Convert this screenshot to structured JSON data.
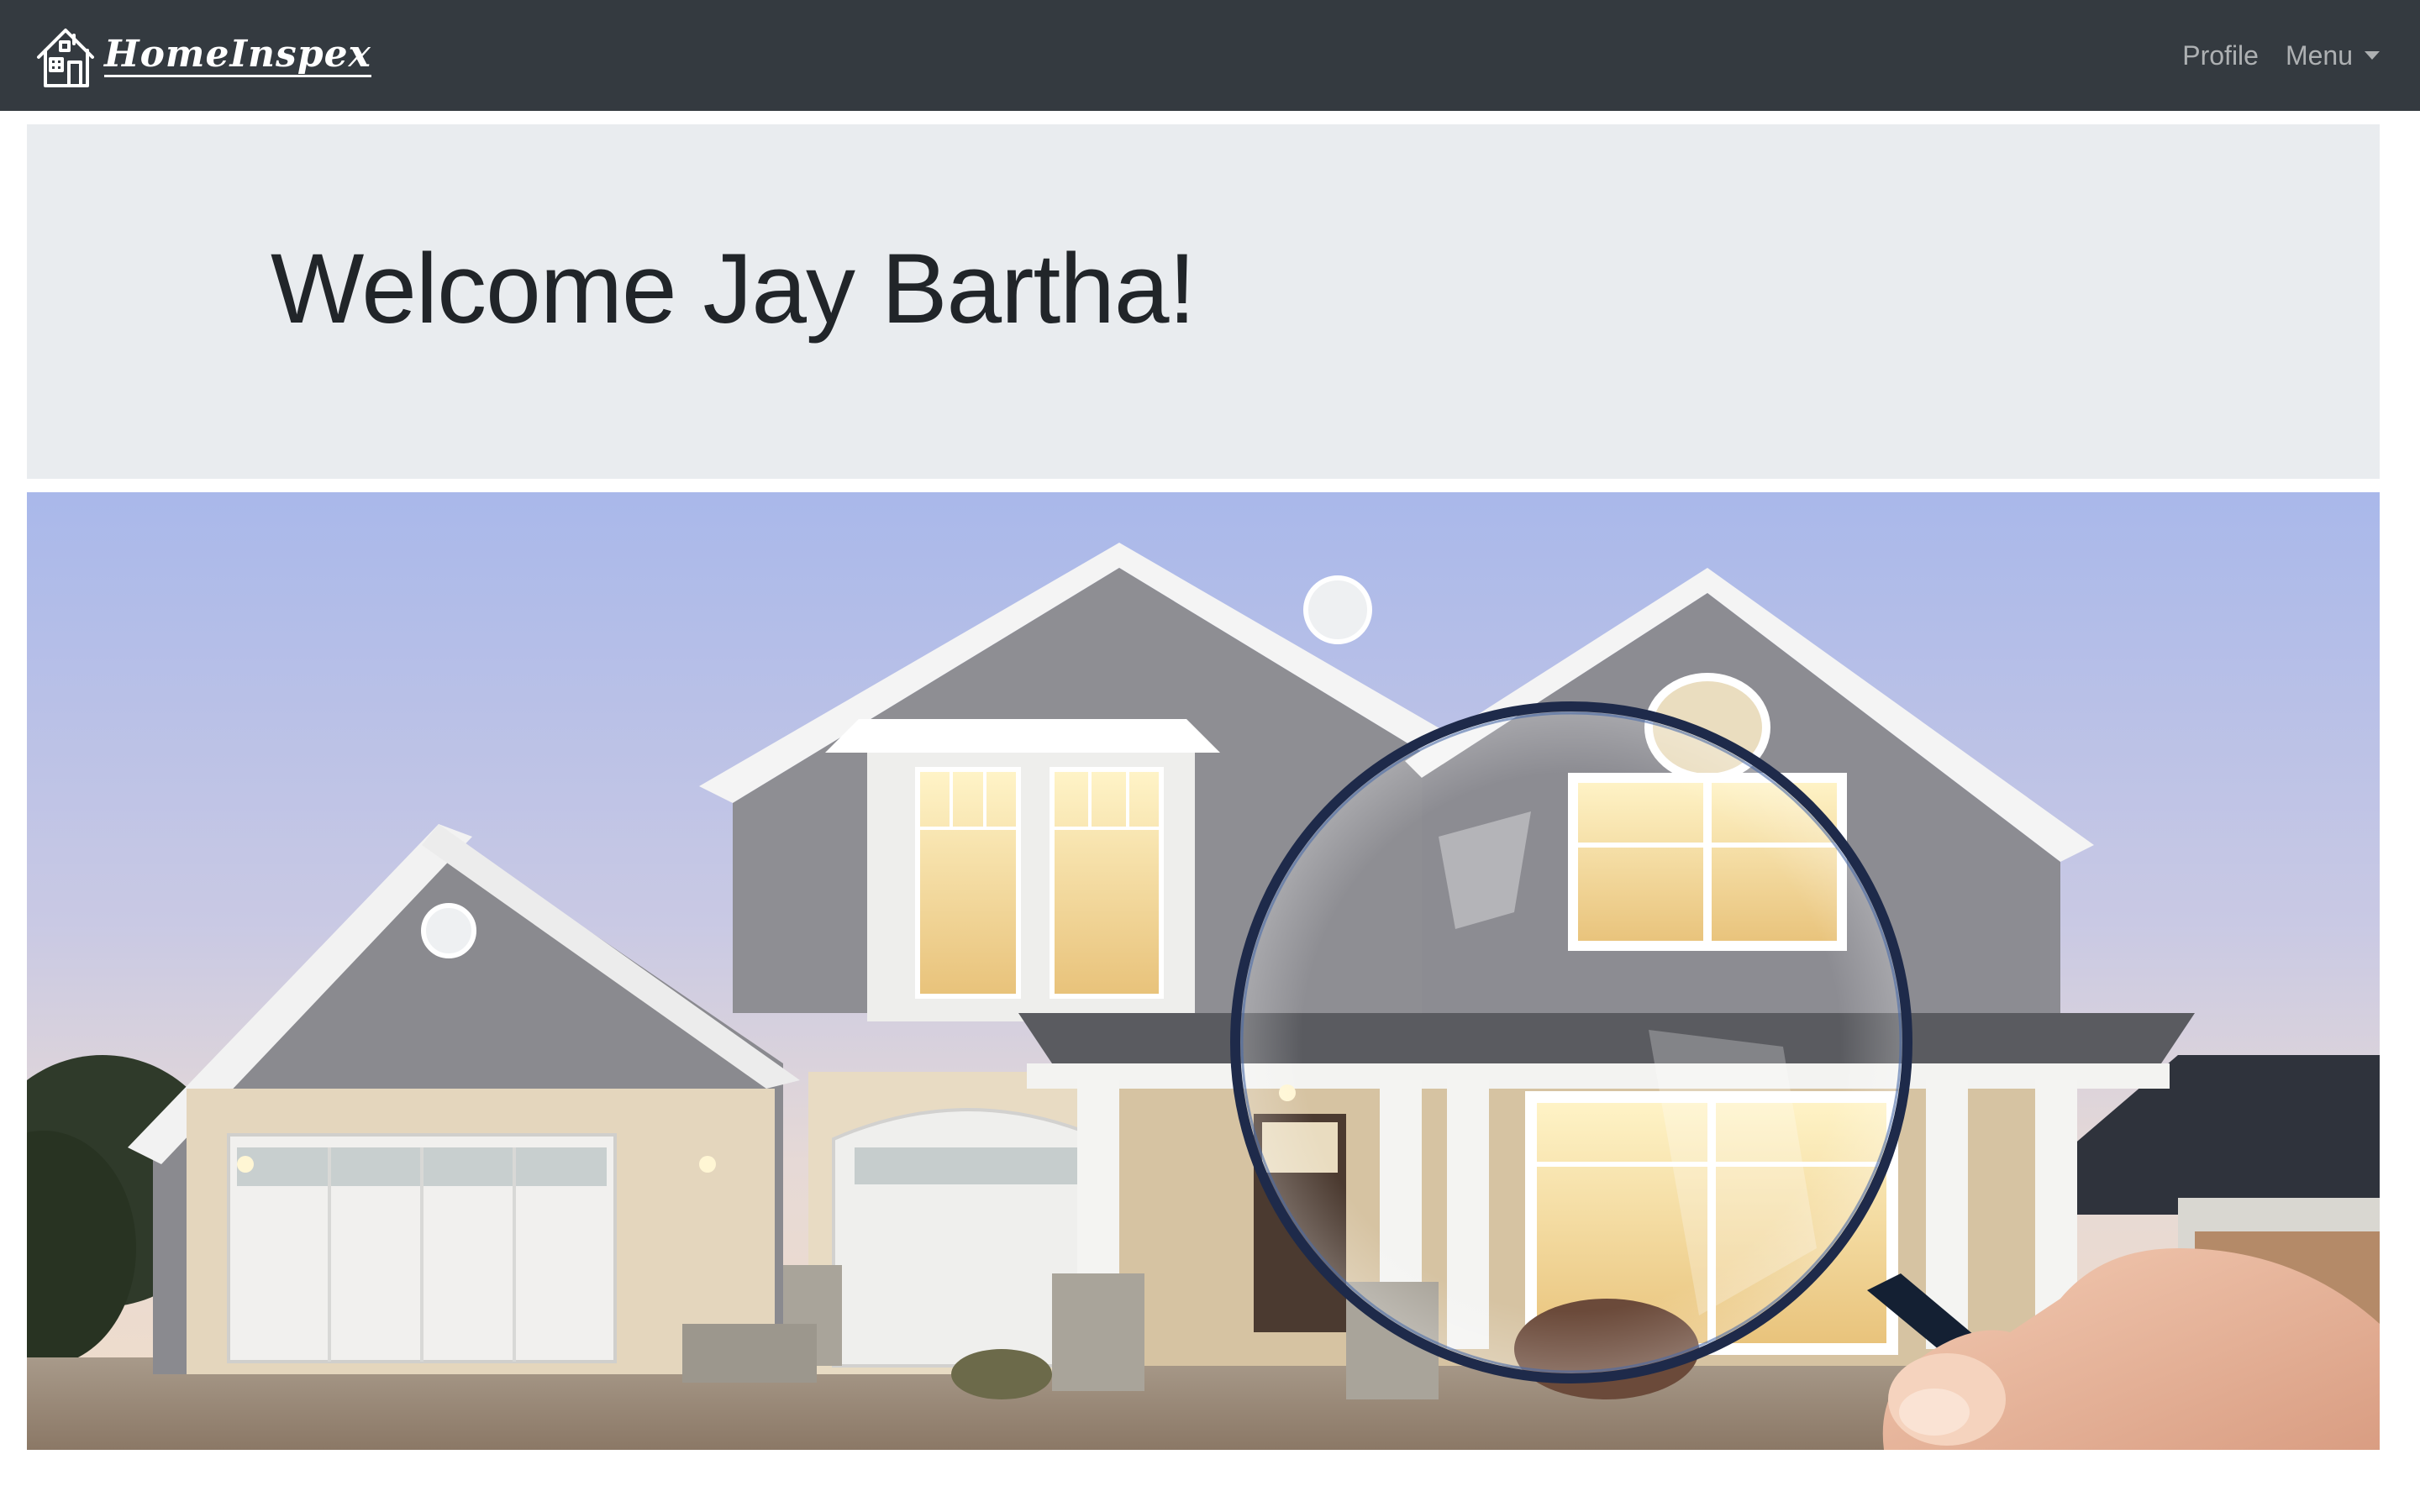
{
  "navbar": {
    "brand_text": "HomeInspex",
    "links": [
      {
        "label": "Profile"
      },
      {
        "label": "Menu"
      }
    ]
  },
  "jumbotron": {
    "heading": "Welcome Jay Bartha!"
  },
  "hero": {
    "alt": "House photo with magnifying glass"
  },
  "colors": {
    "navbar_bg": "#343a40",
    "jumbotron_bg": "#e9ecef",
    "heading_text": "#212529",
    "nav_link": "rgba(255,255,255,0.6)"
  }
}
